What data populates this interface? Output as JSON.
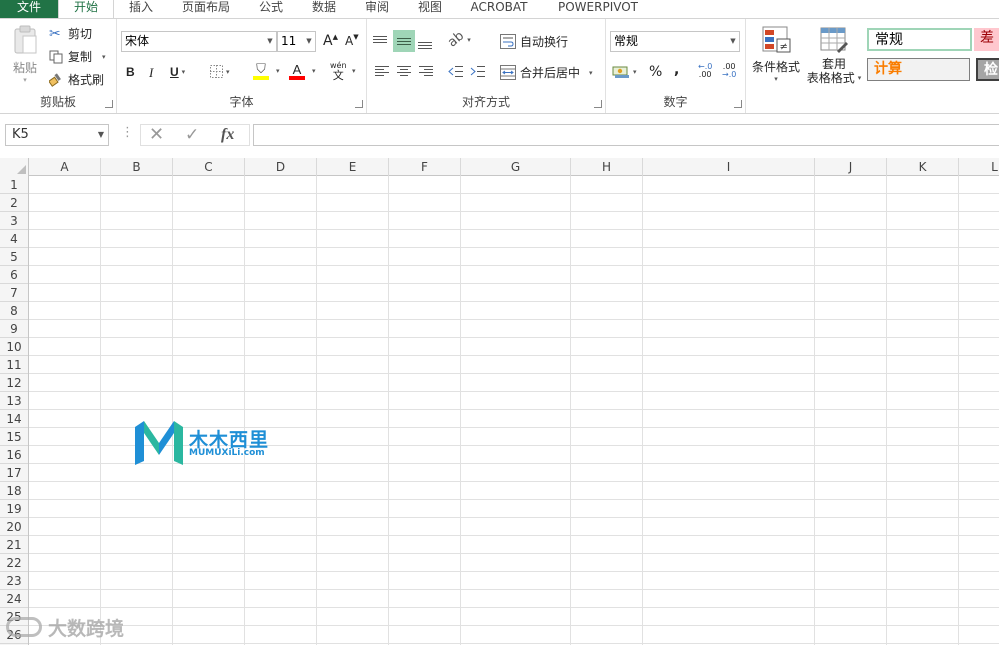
{
  "tabs": {
    "file": "文件",
    "home": "开始",
    "insert": "插入",
    "page_layout": "页面布局",
    "formulas": "公式",
    "data": "数据",
    "review": "审阅",
    "view": "视图",
    "acrobat": "ACROBAT",
    "powerpivot": "POWERPIVOT"
  },
  "clipboard": {
    "paste": "粘贴",
    "cut": "剪切",
    "copy": "复制",
    "format_painter": "格式刷",
    "label": "剪贴板"
  },
  "font": {
    "name": "宋体",
    "size": "11",
    "bold": "B",
    "italic": "I",
    "underline": "U",
    "grow": "A",
    "shrink": "A",
    "phonetic_top": "wén",
    "phonetic_bottom": "文",
    "font_color_letter": "A",
    "label": "字体",
    "fill_color": "#ffff00",
    "font_color": "#ff0000"
  },
  "alignment": {
    "wrap_text": "自动换行",
    "merge_center": "合并后居中",
    "label": "对齐方式"
  },
  "number": {
    "format": "常规",
    "percent": "%",
    "comma": ",",
    "label": "数字"
  },
  "styles": {
    "conditional_format": "条件格式",
    "table_format_line1": "套用",
    "table_format_line2": "表格格式",
    "normal": "常规",
    "bad": "差",
    "calculation": "计算",
    "check": "检"
  },
  "formula_bar": {
    "name_box": "K5",
    "fx": "fx",
    "value": ""
  },
  "grid": {
    "columns": [
      "A",
      "B",
      "C",
      "D",
      "E",
      "F",
      "G",
      "H",
      "I",
      "J",
      "K",
      "L"
    ],
    "rows": [
      "1",
      "2",
      "3",
      "4",
      "5",
      "6",
      "7",
      "8",
      "9",
      "10",
      "11",
      "12",
      "13",
      "14",
      "15",
      "16",
      "17",
      "18",
      "19",
      "20",
      "21",
      "22",
      "23",
      "24",
      "25",
      "26"
    ]
  },
  "logo": {
    "cn": "木木西里",
    "en": "MUMUXiLi.com"
  },
  "watermark": "大数跨境",
  "colors": {
    "accent": "#217346",
    "logo_blue": "#1f8fd6",
    "selected_align": "#9fd5b7"
  }
}
